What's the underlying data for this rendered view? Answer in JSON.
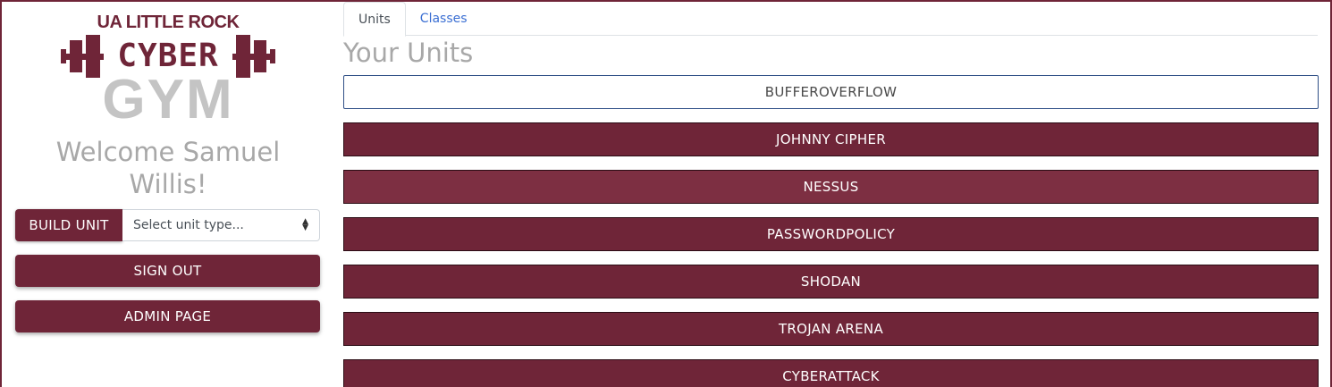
{
  "brand": {
    "line1": "UA LITTLE ROCK",
    "line2": "CYBER",
    "line3": "GYM",
    "colors": {
      "primary": "#6f2538",
      "secondary": "#c4c4c4"
    }
  },
  "sidebar": {
    "welcome": "Welcome Samuel Willis!",
    "build_unit_label": "BUILD UNIT",
    "unit_select_value": "Select unit type...",
    "sign_out_label": "SIGN OUT",
    "admin_page_label": "ADMIN PAGE"
  },
  "tabs": [
    {
      "label": "Units",
      "active": true
    },
    {
      "label": "Classes",
      "active": false
    }
  ],
  "main": {
    "heading": "Your Units",
    "units": [
      {
        "label": "BUFFEROVERFLOW",
        "state": "selected"
      },
      {
        "label": "JOHNNY CIPHER",
        "state": "normal"
      },
      {
        "label": "NESSUS",
        "state": "hover"
      },
      {
        "label": "PASSWORDPOLICY",
        "state": "normal"
      },
      {
        "label": "SHODAN",
        "state": "normal"
      },
      {
        "label": "TROJAN ARENA",
        "state": "normal"
      },
      {
        "label": "CYBERATTACK",
        "state": "normal"
      }
    ]
  }
}
